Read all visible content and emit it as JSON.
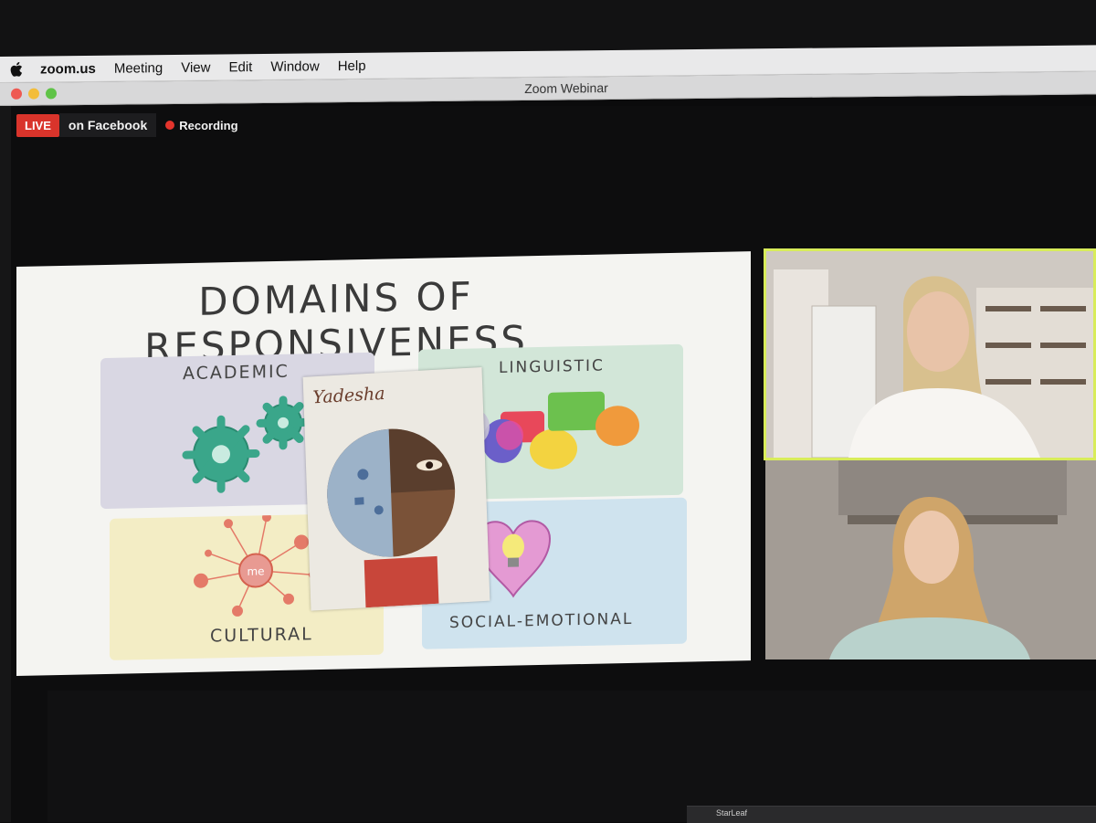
{
  "menubar": {
    "apple_icon": "apple-logo-icon",
    "items": [
      "zoom.us",
      "Meeting",
      "View",
      "Edit",
      "Window",
      "Help"
    ]
  },
  "window": {
    "title": "Zoom Webinar"
  },
  "stream": {
    "live_label": "LIVE",
    "destination": "on Facebook",
    "recording_label": "Recording"
  },
  "slide": {
    "title": "DOMAINS OF RESPONSIVENESS",
    "domains": {
      "academic": "ACADEMIC",
      "linguistic": "LINGUISTIC",
      "cultural": "CULTURAL",
      "social_emotional": "SOCIAL-EMOTIONAL"
    },
    "center_node_label": "me",
    "drawing_name": "Yadesha"
  },
  "dock": {
    "app_label": "StarLeaf"
  },
  "colors": {
    "live_red": "#d9342b",
    "speaker_highlight": "#d8ec5a",
    "recording_dot": "#e3342c"
  }
}
